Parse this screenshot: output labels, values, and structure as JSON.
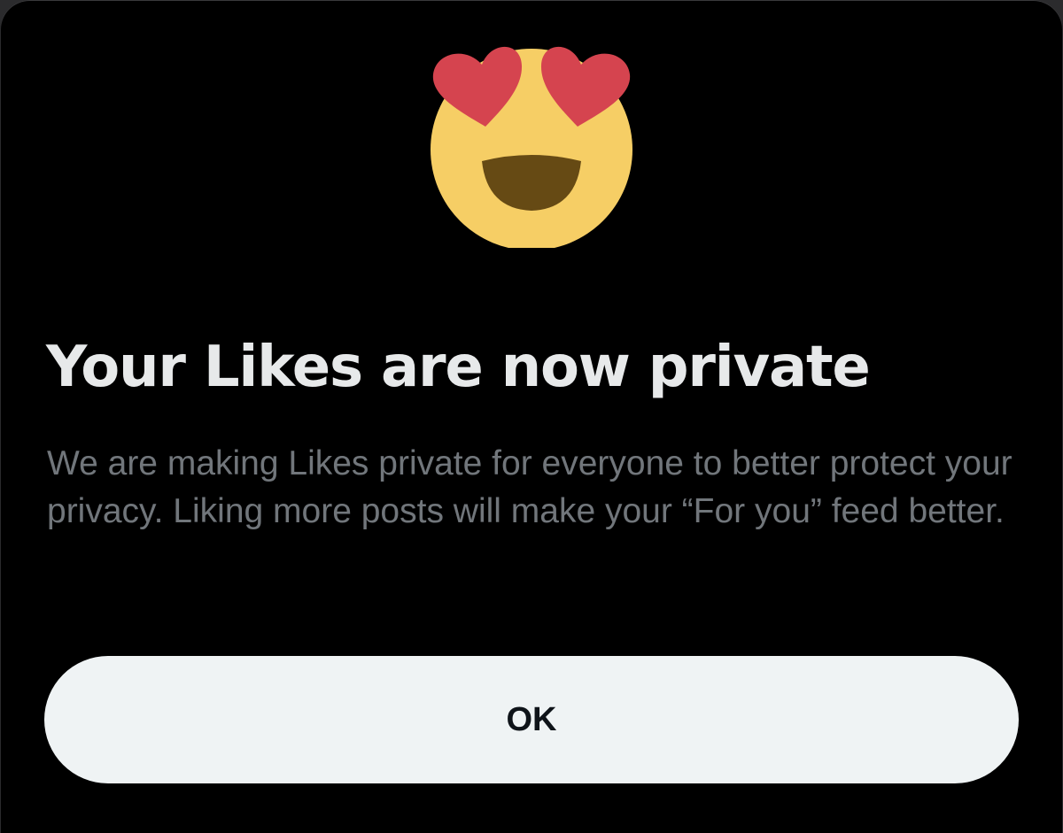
{
  "dialog": {
    "emoji_icon": "smiling-face-with-heart-eyes",
    "title": "Your Likes are now private",
    "body": "We are making Likes private for everyone to better protect your privacy. Liking more posts will make your “For you” feed better.",
    "ok_label": "OK"
  },
  "colors": {
    "background": "#000000",
    "title": "#e7e9ea",
    "body_text": "#71767b",
    "button_bg": "#eff3f4",
    "button_text": "#0f1419",
    "heart": "#d5444f",
    "face": "#f6ce65",
    "mouth": "#664a14"
  }
}
